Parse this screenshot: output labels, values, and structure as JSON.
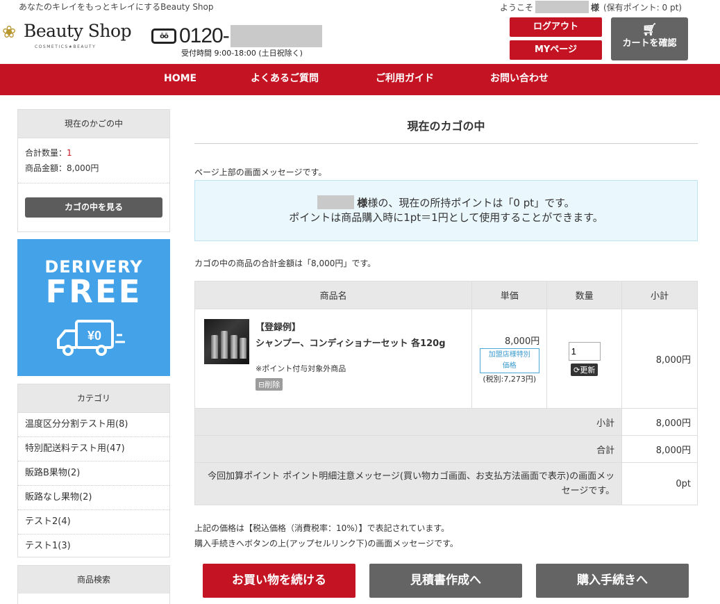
{
  "header": {
    "tagline": "あなたのキレイをもっとキレイにするBeauty Shop",
    "welcome_prefix": "ようこそ",
    "welcome_suffix": "様",
    "points_text": "(保有ポイント: 0 pt)",
    "brand": "Beauty Shop",
    "brand_sub": "COSMETICS★BEAUTY",
    "phone_badge": "ōō",
    "phone": "0120-",
    "hours": "受付時間 9:00-18:00 (土日祝除く)",
    "logout": "ログアウト",
    "mypage": "MYページ",
    "cart": "カートを確認"
  },
  "nav": [
    "HOME",
    "よくあるご質問",
    "ご利用ガイド",
    "お問い合わせ"
  ],
  "sidebar": {
    "cart_title": "現在のかごの中",
    "total_qty_label": "合計数量：",
    "total_qty": "1",
    "total_amount": "商品金額：8,000円",
    "view_cart": "カゴの中を見る",
    "banner_line1": "DERIVERY",
    "banner_line2": "FREE",
    "banner_price": "¥0",
    "category_title": "カテゴリ",
    "categories": [
      "温度区分分割テスト用(8)",
      "特別配送料テスト用(47)",
      "販路B果物(2)",
      "販路なし果物(2)",
      "テスト2(4)",
      "テスト1(3)"
    ],
    "search_title": "商品検索"
  },
  "main": {
    "title": "現在のカゴの中",
    "top_message": "ページ上部の画面メッセージです。",
    "info_line1_suffix": "様の、現在の所持ポイントは「0 pt」です。",
    "info_line2": "ポイントは商品購入時に1pt＝1円として使用することができます。",
    "total_message": "カゴの中の商品の合計金額は「8,000円」です。",
    "table": {
      "headers": [
        "商品名",
        "単価",
        "数量",
        "小計"
      ],
      "item": {
        "label": "【登録例】",
        "name": "シャンプー、コンディショナーセット 各120g",
        "note": "※ポイント付与対象外商品",
        "delete": "削除",
        "price": "8,000円",
        "special_line1": "加盟店様特別",
        "special_line2": "価格",
        "tax_excluded": "(税別:7,273円)",
        "qty": "1",
        "update": "更新",
        "subtotal": "8,000円"
      },
      "subtotal_label": "小計",
      "subtotal_value": "8,000円",
      "total_label": "合計",
      "total_value": "8,000円",
      "points_label": "今回加算ポイント ポイント明細注意メッセージ(買い物カゴ画面、お支払方法画面で表示)の画面メッセージです。",
      "points_value": "0pt"
    },
    "note1": "上記の価格は【税込価格（消費税率：10%）】で表記されています。",
    "note2": "購入手続きへボタンの上(アップセルリンク下)の画面メッセージです。",
    "buttons": {
      "continue": "お買い物を続ける",
      "estimate": "見積書作成へ",
      "checkout": "購入手続きへ"
    }
  },
  "colors": {
    "brand_red": "#c41423",
    "button_gray": "#646464",
    "banner_blue": "#44a3e8"
  }
}
